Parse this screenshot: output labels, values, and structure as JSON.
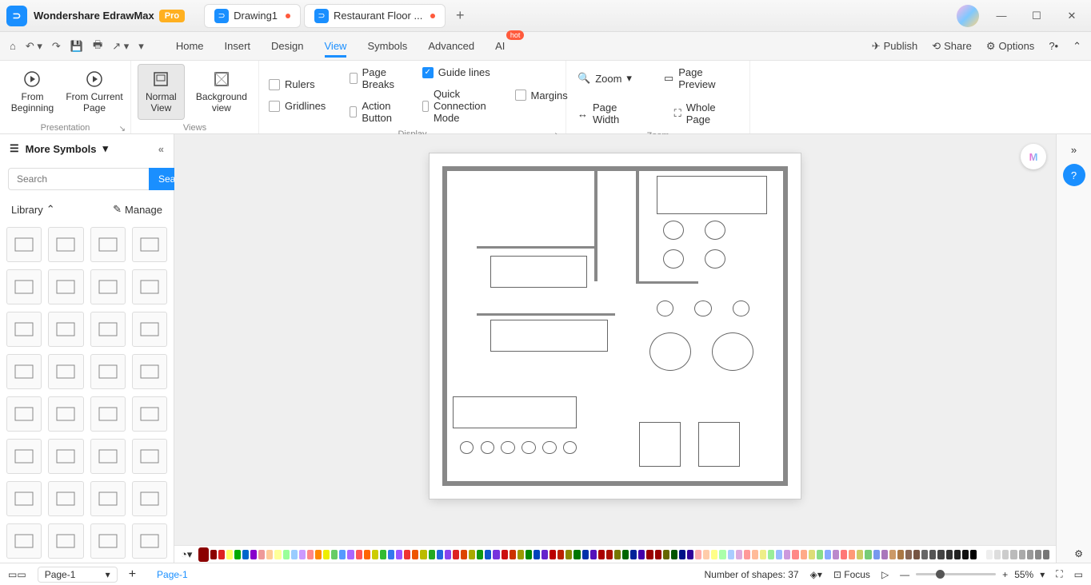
{
  "app": {
    "name": "Wondershare EdrawMax",
    "pro": "Pro"
  },
  "tabs": [
    {
      "label": "Drawing1",
      "dirty": true
    },
    {
      "label": "Restaurant Floor ...",
      "dirty": true
    }
  ],
  "menubar": {
    "items": [
      "Home",
      "Insert",
      "Design",
      "View",
      "Symbols",
      "Advanced",
      "AI"
    ],
    "active": "View",
    "hotIndex": 6,
    "publish": "Publish",
    "share": "Share",
    "options": "Options"
  },
  "ribbon": {
    "presentation": {
      "label": "Presentation",
      "fromBeginning": "From Beginning",
      "fromCurrent": "From Current Page"
    },
    "views": {
      "label": "Views",
      "normal": "Normal View",
      "background": "Background view"
    },
    "display": {
      "label": "Display",
      "rulers": "Rulers",
      "pageBreaks": "Page Breaks",
      "guideLines": "Guide lines",
      "margins": "Margins",
      "gridlines": "Gridlines",
      "actionButton": "Action Button",
      "quickConnection": "Quick Connection Mode",
      "checked": [
        "guideLines"
      ]
    },
    "zoom": {
      "label": "Zoom",
      "zoom": "Zoom",
      "pagePreview": "Page Preview",
      "pageWidth": "Page Width",
      "wholePage": "Whole Page"
    }
  },
  "sidebar": {
    "title": "More Symbols",
    "searchPlaceholder": "Search",
    "searchBtn": "Search",
    "library": "Library",
    "manage": "Manage",
    "symbolCount": 32
  },
  "status": {
    "pageSel": "Page-1",
    "pageTab": "Page-1",
    "shapes": "Number of shapes: 37",
    "focus": "Focus",
    "zoomPct": "55%"
  },
  "colors": [
    "#8b0000",
    "#d22",
    "#ff6",
    "#0a0",
    "#06c",
    "#80c",
    "#e99",
    "#fc9",
    "#ff9",
    "#9f9",
    "#9cf",
    "#c9f",
    "#f88",
    "#f80",
    "#ee0",
    "#6c6",
    "#59f",
    "#a6f",
    "#f55",
    "#f60",
    "#cc0",
    "#3b3",
    "#37e",
    "#95f",
    "#e33",
    "#e50",
    "#bb0",
    "#2a2",
    "#26d",
    "#84e",
    "#d22",
    "#d40",
    "#aa0",
    "#191",
    "#15c",
    "#73d",
    "#c11",
    "#c30",
    "#990",
    "#080",
    "#04b",
    "#62c",
    "#b00",
    "#b20",
    "#880",
    "#070",
    "#03a",
    "#51b",
    "#a00",
    "#a10",
    "#770",
    "#060",
    "#029",
    "#40a",
    "#900",
    "#900",
    "#660",
    "#050",
    "#018",
    "#309",
    "#faa",
    "#fca",
    "#ff8",
    "#afa",
    "#acf",
    "#dad",
    "#f99",
    "#fb9",
    "#ee8",
    "#9e9",
    "#9bf",
    "#c9d",
    "#f88",
    "#fa8",
    "#dd7",
    "#8d8",
    "#8af",
    "#b8c",
    "#f77",
    "#f97",
    "#cc6",
    "#7c7",
    "#79e",
    "#a7b",
    "#c96",
    "#a74",
    "#865",
    "#754",
    "#666",
    "#555",
    "#444",
    "#333",
    "#222",
    "#111",
    "#000",
    "#fff",
    "#eee",
    "#ddd",
    "#ccc",
    "#bbb",
    "#aaa",
    "#999",
    "#888",
    "#777"
  ]
}
